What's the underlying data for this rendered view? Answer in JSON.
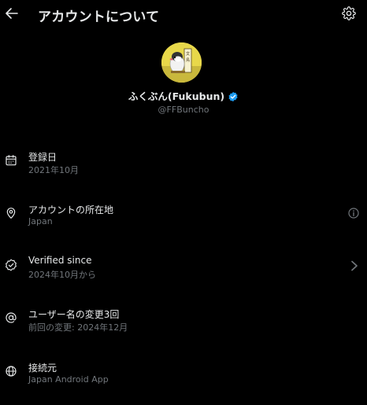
{
  "header": {
    "title": "アカウントについて",
    "back_icon": "arrow-left-icon",
    "settings_icon": "gear-icon"
  },
  "profile": {
    "display_name": "ふくぶん(Fukubun)",
    "handle": "@FFBuncho",
    "verified_color": "#1d9bf0"
  },
  "rows": [
    {
      "icon": "calendar-icon",
      "title": "登録日",
      "subtitle": "2021年10月"
    },
    {
      "icon": "location-pin-icon",
      "title": "アカウントの所在地",
      "subtitle": "Japan",
      "right_icon": "info-icon"
    },
    {
      "icon": "verified-check-icon",
      "title": "Verified since",
      "subtitle": "2024年10月から",
      "right_icon": "chevron-right-icon"
    },
    {
      "icon": "at-sign-icon",
      "title": "ユーザー名の変更3回",
      "subtitle": "前回の変更: 2024年12月"
    },
    {
      "icon": "globe-icon",
      "title": "接続元",
      "subtitle": "Japan Android App"
    }
  ],
  "colors": {
    "background": "#000000",
    "primary_text": "#e7e9ea",
    "secondary_text": "#71767b",
    "accent": "#1d9bf0"
  }
}
